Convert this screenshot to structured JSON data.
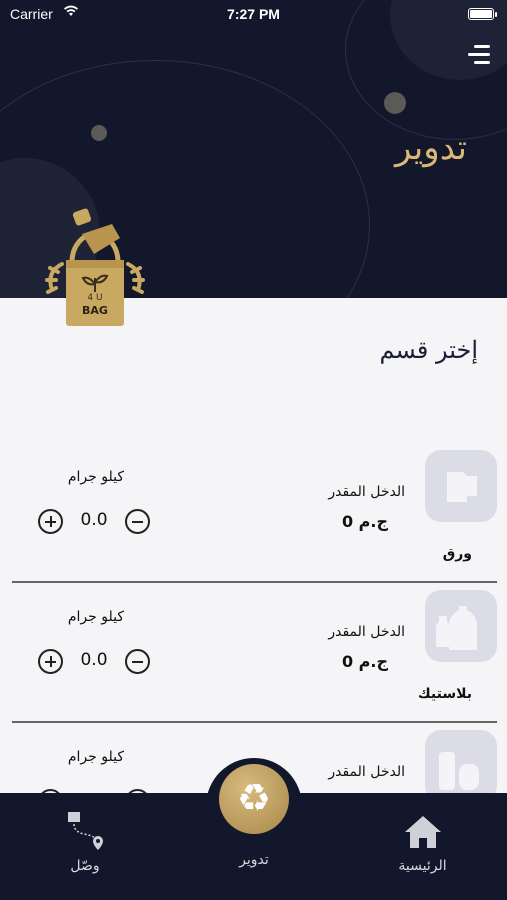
{
  "status_bar": {
    "carrier": "Carrier",
    "wifi_icon": "wifi-icon",
    "time": "7:27 PM",
    "battery_icon": "battery-icon"
  },
  "header": {
    "title": "تدوير",
    "menu_icon": "menu-icon",
    "logo": {
      "text_top": "4 U",
      "text_bottom": "BAG"
    }
  },
  "panel": {
    "section_title": "إختر قسم"
  },
  "categories": [
    {
      "name": "ورق",
      "icon": "paper-icon",
      "income_label": "الدخل المقدر",
      "income_value": "0 ج.م",
      "unit_label": "كيلو جرام",
      "quantity": "0.0"
    },
    {
      "name": "بلاستيك",
      "icon": "plastic-bottle-icon",
      "income_label": "الدخل المقدر",
      "income_value": "0 ج.م",
      "unit_label": "كيلو جرام",
      "quantity": "0.0"
    },
    {
      "name": "",
      "icon": "cans-icon",
      "income_label": "الدخل المقدر",
      "income_value": "",
      "unit_label": "كيلو جرام",
      "quantity": ""
    }
  ],
  "tabbar": {
    "home": {
      "label": "الرئيسية",
      "icon": "home-icon"
    },
    "recycle": {
      "label": "تدوير",
      "icon": "recycle-icon",
      "glyph": "♻"
    },
    "connect": {
      "label": "وصّل",
      "icon": "delivery-route-icon"
    }
  },
  "colors": {
    "header_bg": "#12172b",
    "accent_gold": "#d9b877",
    "panel_bg": "#f5f5f7",
    "icon_tile": "#dcdce6"
  }
}
